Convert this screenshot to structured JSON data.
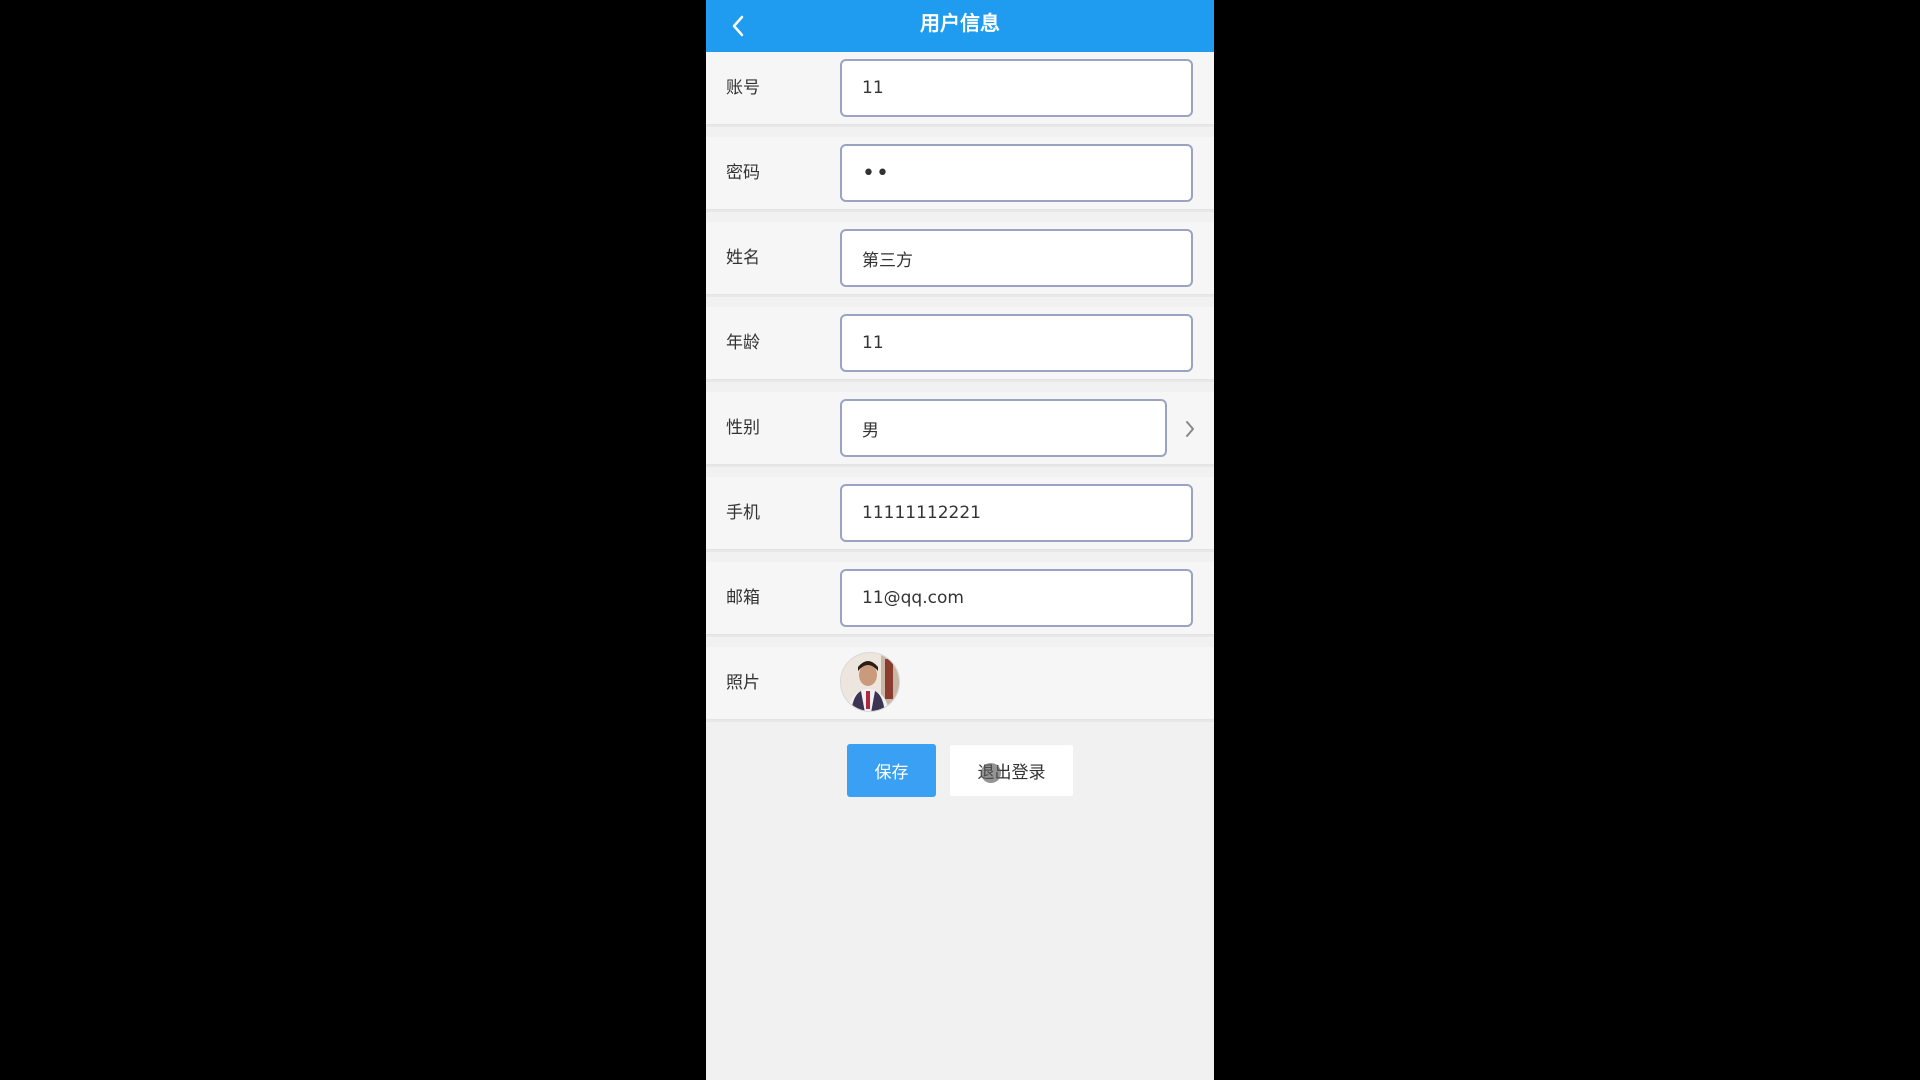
{
  "header": {
    "title": "用户信息",
    "background": "#1f9cf0"
  },
  "fields": [
    {
      "label": "账号",
      "value": "11"
    },
    {
      "label": "密码",
      "value": "••"
    },
    {
      "label": "姓名",
      "value": "第三方"
    },
    {
      "label": "年龄",
      "value": "11"
    },
    {
      "label": "性别",
      "value": "男"
    },
    {
      "label": "手机",
      "value": "11111112221"
    },
    {
      "label": "邮箱",
      "value": "11@qq.com"
    }
  ],
  "photo": {
    "label": "照片",
    "icon": "avatar-photo"
  },
  "buttons": {
    "save_label": "保存",
    "logout_label": "退出登录"
  },
  "colors": {
    "accent": "#3aa0f3",
    "input_border": "#9aa3c2"
  }
}
